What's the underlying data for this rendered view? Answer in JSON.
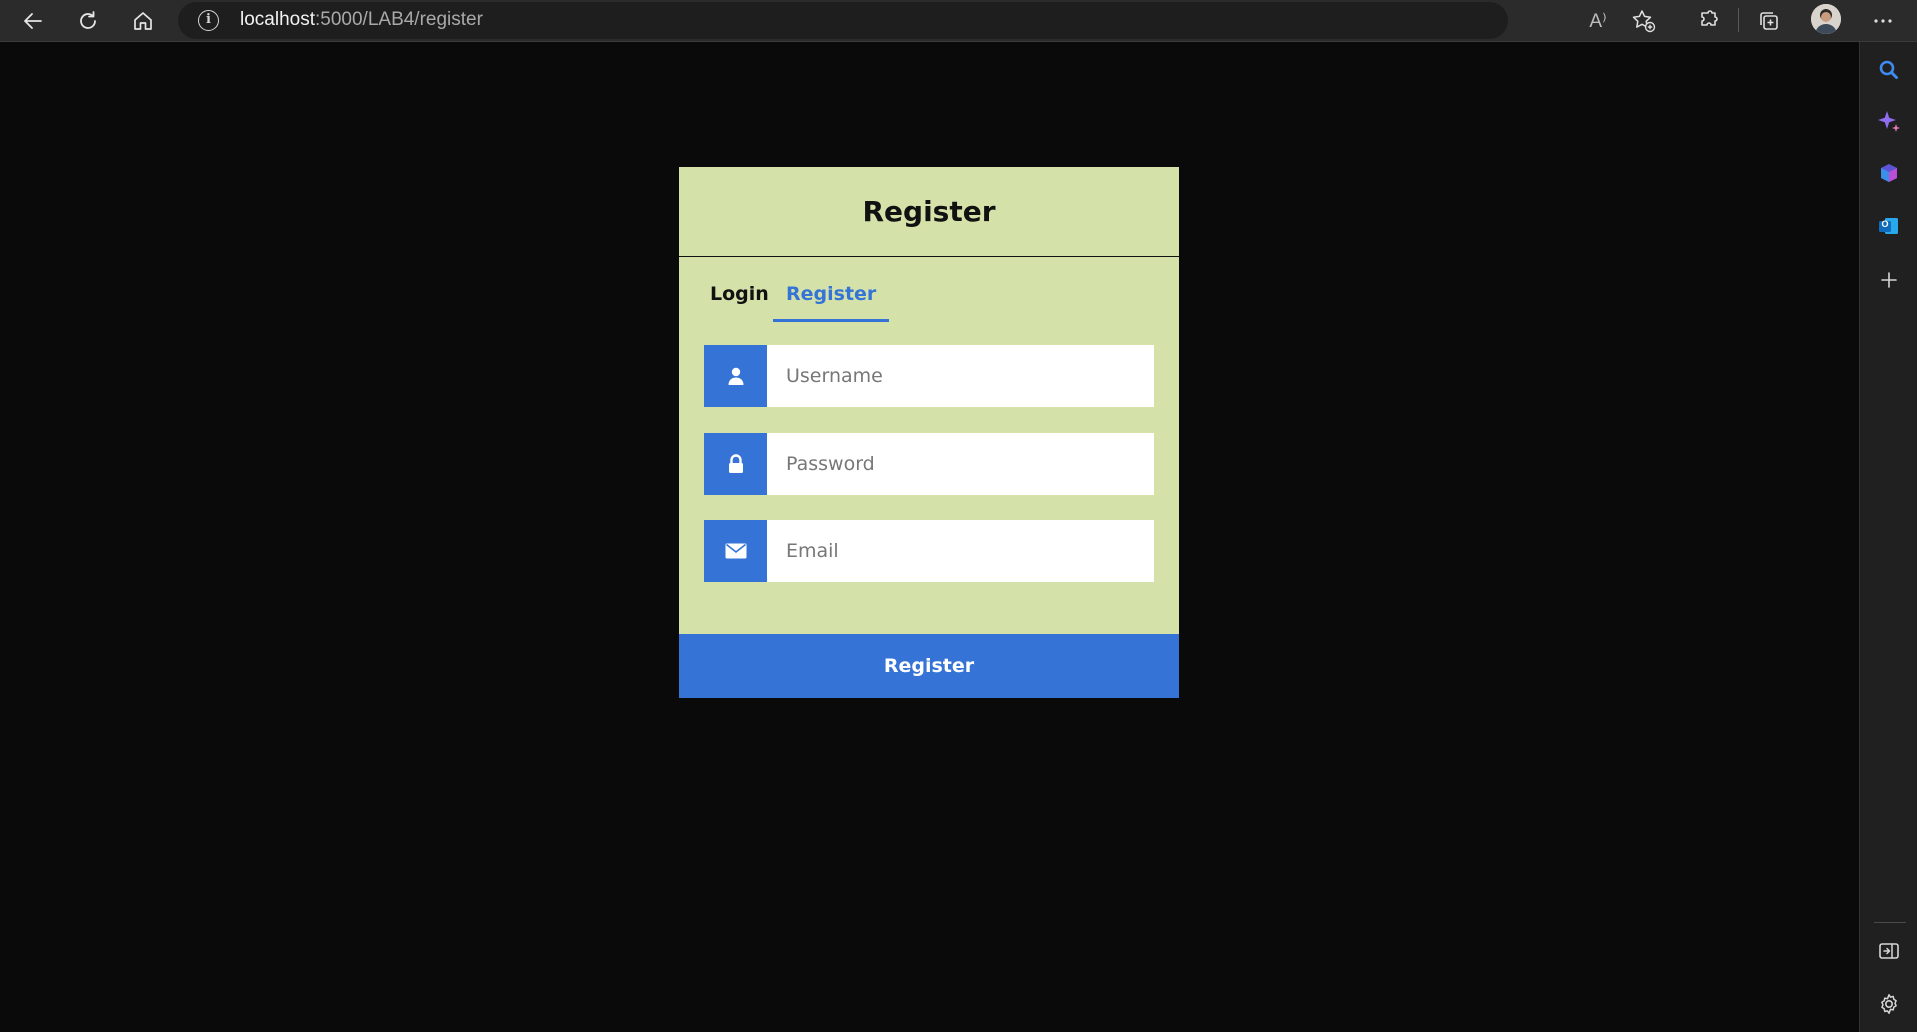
{
  "browser": {
    "address": {
      "host": "localhost",
      "path": ":5000/LAB4/register"
    },
    "icons": {
      "back": "back-arrow-icon",
      "refresh": "refresh-icon",
      "home": "home-icon",
      "info": "info-icon",
      "read_aloud": "read-aloud-icon",
      "favorites": "add-favorite-icon",
      "extensions": "extensions-icon",
      "collections": "collections-icon",
      "profile": "profile-avatar",
      "more": "more-options-icon"
    },
    "read_aloud_label": "A⁾"
  },
  "sidebar": {
    "items": [
      "search-icon",
      "copilot-icon",
      "office-icon",
      "outlook-icon",
      "add-icon"
    ],
    "bottom": [
      "sidebar-toggle-icon",
      "settings-icon"
    ],
    "outlook_letter": "O"
  },
  "card": {
    "title": "Register",
    "tabs": [
      {
        "label": "Login",
        "active": false
      },
      {
        "label": "Register",
        "active": true
      }
    ],
    "fields": [
      {
        "icon": "user-icon",
        "placeholder": "Username",
        "value": ""
      },
      {
        "icon": "lock-icon",
        "placeholder": "Password",
        "value": ""
      },
      {
        "icon": "envelope-icon",
        "placeholder": "Email",
        "value": ""
      }
    ],
    "submit_label": "Register"
  },
  "colors": {
    "card_bg": "#d4e2aa",
    "accent": "#3574d6",
    "page_bg": "#0a0a0a",
    "topbar_bg": "#2b2b2b"
  }
}
